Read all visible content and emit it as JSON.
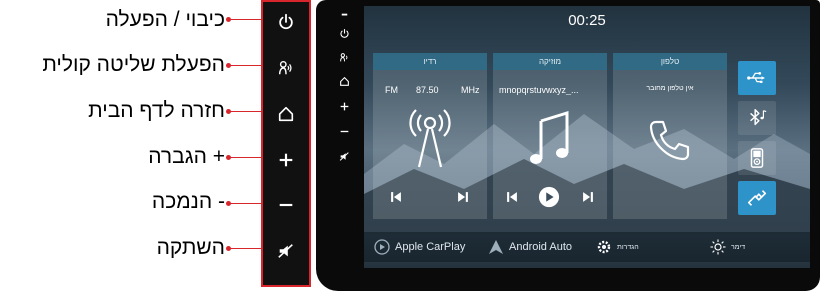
{
  "callouts": [
    {
      "label": "כיבוי / הפעלה",
      "icon": "power-icon"
    },
    {
      "label": "הפעלת שליטה קולית",
      "icon": "voice-icon"
    },
    {
      "label": "חזרה לדף הבית",
      "icon": "home-icon"
    },
    {
      "label": "+ הגברה",
      "icon": "plus-icon"
    },
    {
      "label": "- הנמכה",
      "icon": "minus-icon"
    },
    {
      "label": "השתקה",
      "icon": "mute-icon"
    }
  ],
  "screen": {
    "clock": "00:25",
    "cards": {
      "radio": {
        "title": "רדיו",
        "band": "FM",
        "frequency": "87.50",
        "unit": "MHz"
      },
      "music": {
        "title": "מוזיקה",
        "track": "mnopqrstuvwxyz_..."
      },
      "phone": {
        "title": "טלפון",
        "status": "אין טלפון מחובר"
      }
    },
    "connections": [
      {
        "name": "usb",
        "icon": "usb-icon",
        "active": true
      },
      {
        "name": "bluetooth-music",
        "icon": "bluetooth-music-icon",
        "active": false
      },
      {
        "name": "ipod",
        "icon": "ipod-icon",
        "active": false
      },
      {
        "name": "link",
        "icon": "link-icon",
        "active": true
      }
    ],
    "bottom_bar": {
      "carplay": "Apple CarPlay",
      "android": "Android Auto",
      "settings": "הגדרות",
      "dimmer": "דימר"
    }
  },
  "colors": {
    "accent": "#2e93c8",
    "highlight": "#d9262c"
  }
}
